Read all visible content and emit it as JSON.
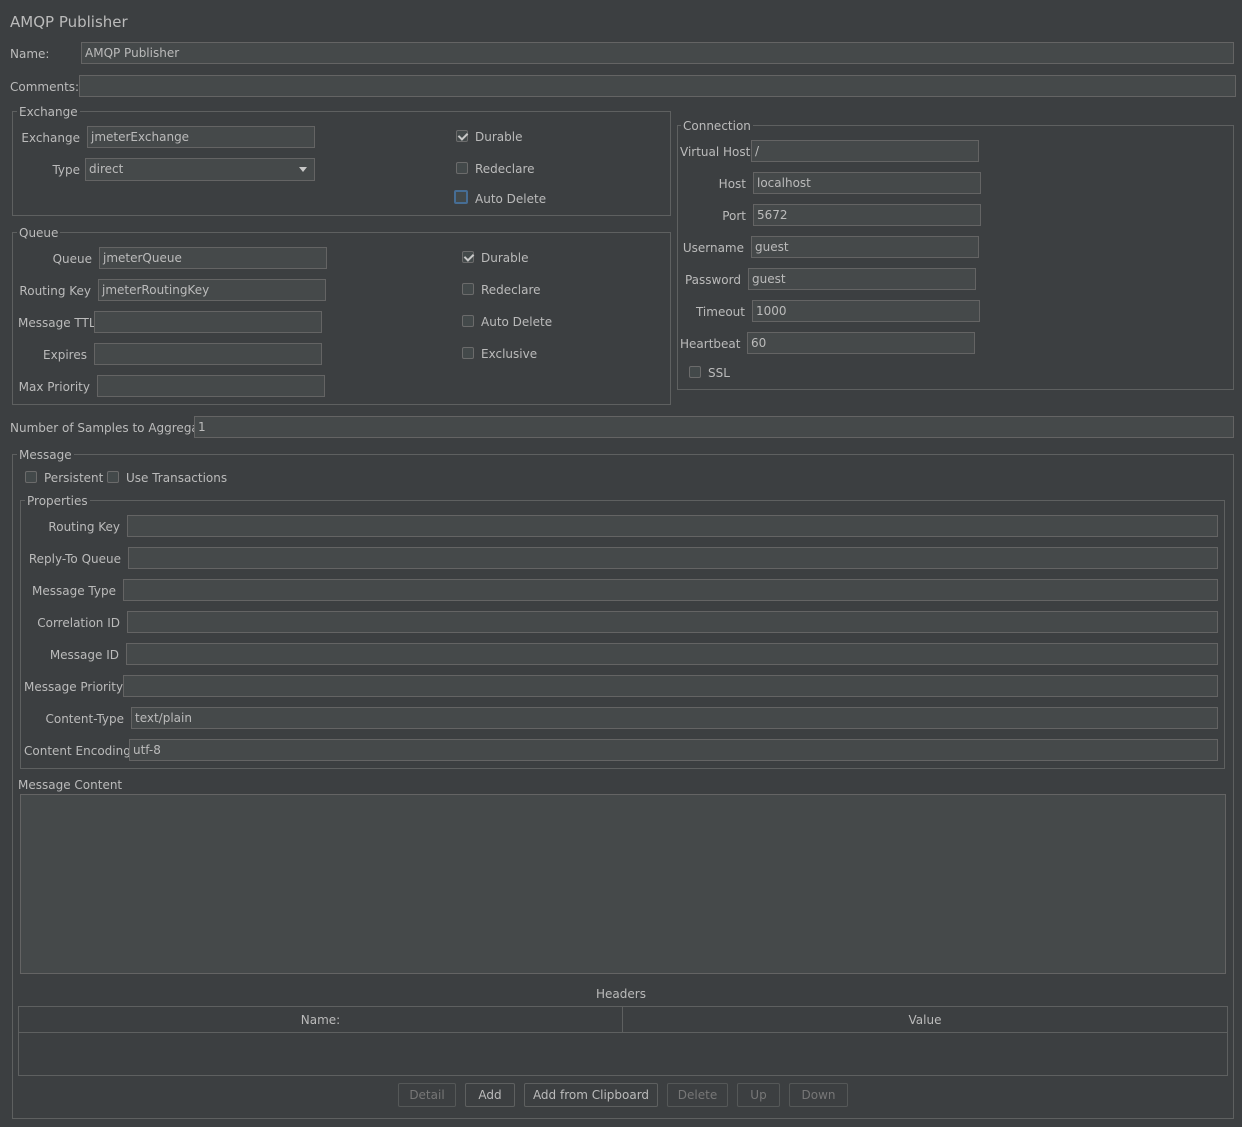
{
  "title": "AMQP Publisher",
  "name": {
    "label": "Name:",
    "value": "AMQP Publisher"
  },
  "comments": {
    "label": "Comments:",
    "value": ""
  },
  "exchange": {
    "group_title": "Exchange",
    "exchange_label": "Exchange",
    "exchange_value": "jmeterExchange",
    "type_label": "Type",
    "type_value": "direct",
    "durable_label": "Durable",
    "redeclare_label": "Redeclare",
    "auto_delete_label": "Auto Delete",
    "durable": true,
    "redeclare": false,
    "auto_delete": false
  },
  "queue": {
    "group_title": "Queue",
    "queue_label": "Queue",
    "queue_value": "jmeterQueue",
    "routing_key_label": "Routing Key",
    "routing_key_value": "jmeterRoutingKey",
    "ttl_label": "Message TTL",
    "ttl_value": "",
    "expires_label": "Expires",
    "expires_value": "",
    "max_priority_label": "Max Priority",
    "max_priority_value": "",
    "durable_label": "Durable",
    "redeclare_label": "Redeclare",
    "auto_delete_label": "Auto Delete",
    "exclusive_label": "Exclusive",
    "durable": true,
    "redeclare": false,
    "auto_delete": false,
    "exclusive": false
  },
  "connection": {
    "group_title": "Connection",
    "vhost_label": "Virtual Host",
    "vhost_value": "/",
    "host_label": "Host",
    "host_value": "localhost",
    "port_label": "Port",
    "port_value": "5672",
    "username_label": "Username",
    "username_value": "guest",
    "password_label": "Password",
    "password_value": "guest",
    "timeout_label": "Timeout",
    "timeout_value": "1000",
    "heartbeat_label": "Heartbeat",
    "heartbeat_value": "60",
    "ssl_label": "SSL",
    "ssl": false
  },
  "samples": {
    "label": "Number of Samples to Aggregate",
    "value": "1"
  },
  "message": {
    "group_title": "Message",
    "persistent_label": "Persistent",
    "use_transactions_label": "Use Transactions",
    "properties_title": "Properties",
    "routing_key_label": "Routing Key",
    "routing_key_value": "",
    "reply_to_label": "Reply-To Queue",
    "reply_to_value": "",
    "message_type_label": "Message Type",
    "message_type_value": "",
    "correlation_id_label": "Correlation ID",
    "correlation_id_value": "",
    "message_id_label": "Message ID",
    "message_id_value": "",
    "priority_label": "Message Priority",
    "priority_value": "",
    "content_type_label": "Content-Type",
    "content_type_value": "text/plain",
    "content_encoding_label": "Content Encoding",
    "content_encoding_value": "utf-8",
    "content_label": "Message Content",
    "content_value": ""
  },
  "headers": {
    "title": "Headers",
    "columns": [
      "Name:",
      "Value"
    ],
    "buttons": {
      "detail": "Detail",
      "add": "Add",
      "add_clipboard": "Add from Clipboard",
      "delete": "Delete",
      "up": "Up",
      "down": "Down"
    }
  }
}
